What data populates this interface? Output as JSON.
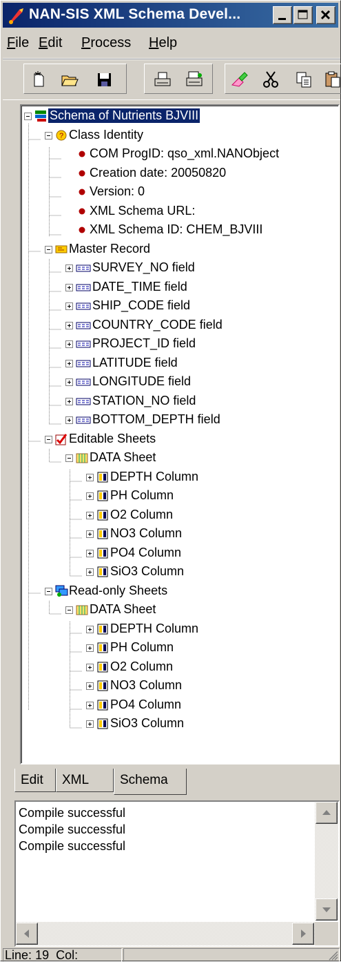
{
  "window": {
    "title": "NAN-SIS XML Schema Devel..."
  },
  "menu": [
    {
      "accel": "F",
      "rest": "ile"
    },
    {
      "accel": "E",
      "rest": "dit"
    },
    {
      "accel": "P",
      "rest": "rocess"
    },
    {
      "accel": "H",
      "rest": "elp"
    }
  ],
  "tree": {
    "root": "Schema of Nutrients BJVIII",
    "class_identity": {
      "label": "Class Identity",
      "items": [
        "COM ProgID: qso_xml.NANObject",
        "Creation date: 20050820",
        "Version: 0",
        "XML Schema URL:",
        "XML Schema ID: CHEM_BJVIII"
      ]
    },
    "master_record": {
      "label": "Master Record",
      "fields": [
        "SURVEY_NO field",
        "DATE_TIME field",
        "SHIP_CODE field",
        "COUNTRY_CODE field",
        "PROJECT_ID field",
        "LATITUDE field",
        "LONGITUDE field",
        "STATION_NO field",
        "BOTTOM_DEPTH field"
      ]
    },
    "editable_sheets": {
      "label": "Editable Sheets",
      "sheet": "DATA Sheet",
      "columns": [
        "DEPTH Column",
        "PH Column",
        "O2 Column",
        "NO3 Column",
        "PO4 Column",
        "SiO3 Column"
      ]
    },
    "readonly_sheets": {
      "label": "Read-only Sheets",
      "sheet": "DATA Sheet",
      "columns": [
        "DEPTH Column",
        "PH Column",
        "O2 Column",
        "NO3 Column",
        "PO4 Column",
        "SiO3 Column"
      ]
    }
  },
  "tabs": [
    "Edit",
    "XML",
    "Schema"
  ],
  "output": [
    "Compile successful",
    "Compile successful",
    "Compile successful"
  ],
  "status": {
    "line_label": "Line:",
    "line": "19",
    "col_label": "Col:",
    "col": ""
  },
  "colors": {
    "title_bar": "#0a246a",
    "selection": "#0a246a",
    "face": "#d4d0c8"
  }
}
